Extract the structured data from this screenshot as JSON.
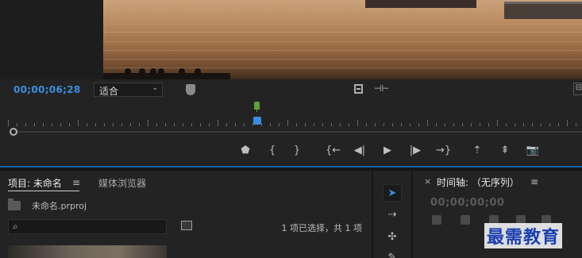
{
  "program_monitor": {
    "timecode": "00;00;06;28",
    "zoom_select": {
      "value": "适合",
      "chevron": "⌄"
    },
    "playback_position": 0.44,
    "transport_buttons": [
      {
        "name": "add-marker-button",
        "glyph": "⬟"
      },
      {
        "name": "mark-in-button",
        "glyph": "{"
      },
      {
        "name": "mark-out-button",
        "glyph": "}"
      },
      {
        "name": "go-to-in-button",
        "glyph": "{←"
      },
      {
        "name": "step-back-button",
        "glyph": "◀|"
      },
      {
        "name": "play-button",
        "glyph": "▶"
      },
      {
        "name": "step-forward-button",
        "glyph": "|▶"
      },
      {
        "name": "go-to-out-button",
        "glyph": "→}"
      },
      {
        "name": "lift-button",
        "glyph": "⇡"
      },
      {
        "name": "extract-button",
        "glyph": "⇞"
      },
      {
        "name": "export-frame-button",
        "glyph": "📷"
      }
    ]
  },
  "project_panel": {
    "tab_project": "项目: 未命名",
    "tab_menu": "≡",
    "tab_media": "媒体浏览器",
    "project_file": "未命名.prproj",
    "search": {
      "icon": "⌕",
      "placeholder": ""
    },
    "selection_status": "1 项已选择，共 1 项"
  },
  "tools": [
    {
      "name": "selection-tool",
      "glyph": "➤",
      "active": true
    },
    {
      "name": "track-select-tool",
      "glyph": "⇢",
      "active": false
    },
    {
      "name": "ripple-edit-tool",
      "glyph": "✣",
      "active": false
    },
    {
      "name": "razor-tool",
      "glyph": "✎",
      "active": false
    }
  ],
  "timeline_panel": {
    "close": "×",
    "title": "时间轴: （无序列）",
    "menu": "≡",
    "timecode": "00;00;00;00"
  },
  "watermark": "最需教育",
  "colors": {
    "accent_blue": "#3b8ee0",
    "marker_green": "#5f9e3a"
  }
}
